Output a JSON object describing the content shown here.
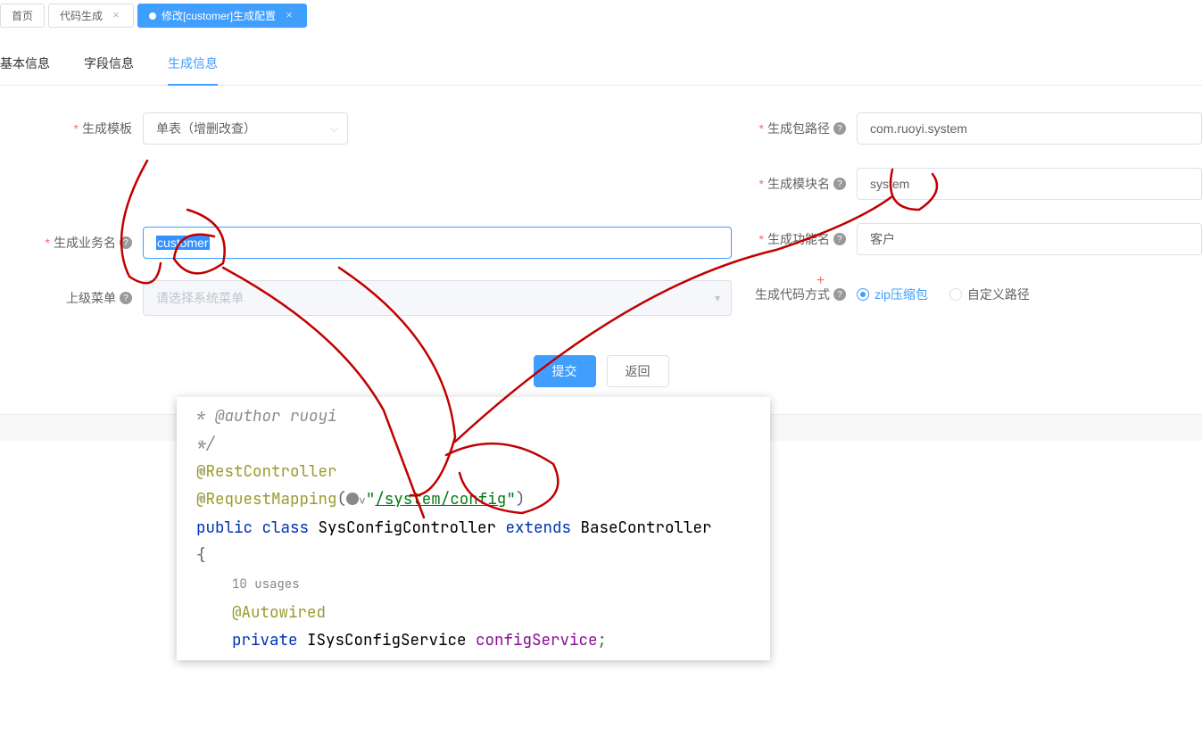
{
  "tabs": {
    "home": "首页",
    "code_gen": "代码生成",
    "edit_customer": "修改[customer]生成配置"
  },
  "subtabs": {
    "basic": "基本信息",
    "fields": "字段信息",
    "gen": "生成信息"
  },
  "form": {
    "template_label": "生成模板",
    "template_value": "单表（增删改查）",
    "package_label": "生成包路径",
    "package_value": "com.ruoyi.system",
    "module_label": "生成模块名",
    "module_value": "system",
    "business_label": "生成业务名",
    "business_value": "customer",
    "function_label": "生成功能名",
    "function_value": "客户",
    "parent_menu_label": "上级菜单",
    "parent_menu_placeholder": "请选择系统菜单",
    "code_method_label": "生成代码方式",
    "radio_zip": "zip压缩包",
    "radio_path": "自定义路径"
  },
  "buttons": {
    "submit": "提交",
    "back": "返回"
  },
  "code": {
    "author_line": " * @author ruoyi",
    "comment_end": " */",
    "rest_controller": "@RestController",
    "request_mapping": "@RequestMapping",
    "mapping_path": "/system/config",
    "public": "public",
    "class_kw": "class",
    "class_name": "SysConfigController",
    "extends_kw": "extends",
    "base_class": "BaseController",
    "brace_open": "{",
    "usages": "10 usages",
    "autowired": "@Autowired",
    "private_kw": "private",
    "service_type": "ISysConfigService",
    "service_field": "configService",
    "semicolon": ";"
  }
}
